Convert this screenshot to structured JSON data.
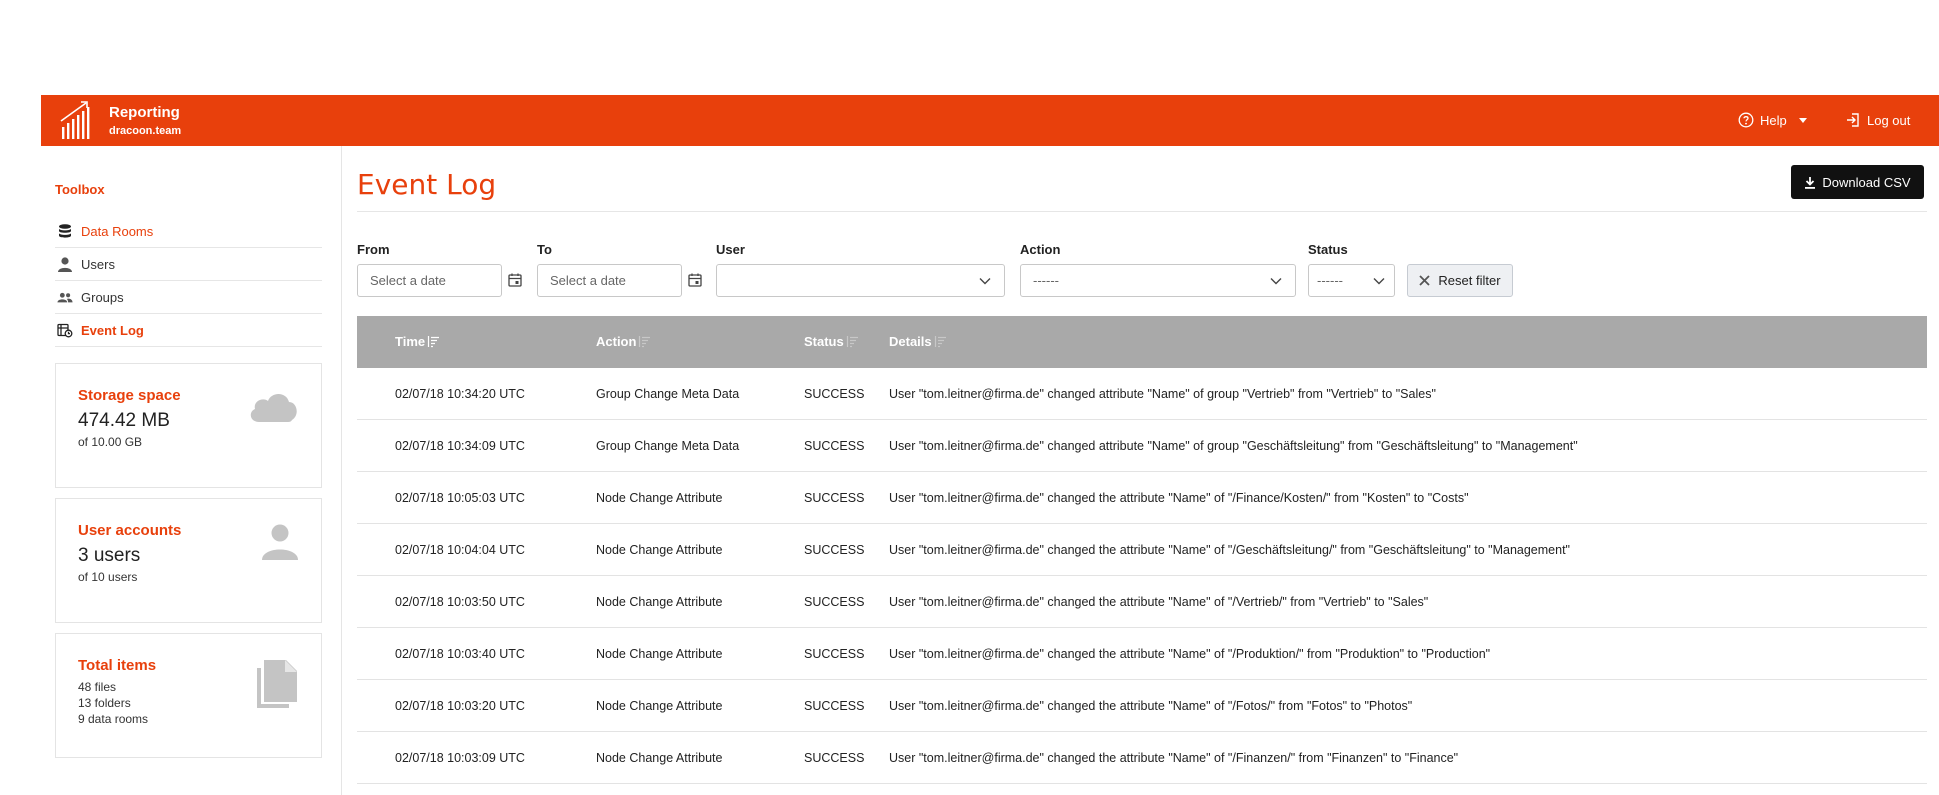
{
  "header": {
    "app_title": "Reporting",
    "app_subtitle": "dracoon.team",
    "help_label": "Help",
    "logout_label": "Log out",
    "brand_color": "#e8400c"
  },
  "sidebar": {
    "toolbox_label": "Toolbox",
    "items": [
      {
        "label": "Data Rooms",
        "icon": "database-icon"
      },
      {
        "label": "Users",
        "icon": "user-icon"
      },
      {
        "label": "Groups",
        "icon": "group-icon"
      },
      {
        "label": "Event Log",
        "icon": "event-log-icon"
      }
    ],
    "cards": [
      {
        "title": "Storage space",
        "value": "474.42 MB",
        "lines": [
          "of 10.00 GB"
        ],
        "icon": "cloud-icon"
      },
      {
        "title": "User accounts",
        "value": "3 users",
        "lines": [
          "of 10 users"
        ],
        "icon": "person-icon"
      },
      {
        "title": "Total items",
        "value": "",
        "lines": [
          "48 files",
          "13 folders",
          "9 data rooms"
        ],
        "icon": "files-icon"
      }
    ]
  },
  "main": {
    "title": "Event Log",
    "download_label": "Download CSV",
    "filters": {
      "from_label": "From",
      "from_placeholder": "Select a date",
      "to_label": "To",
      "to_placeholder": "Select a date",
      "user_label": "User",
      "user_value": "",
      "action_label": "Action",
      "action_value": "------",
      "status_label": "Status",
      "status_value": "------",
      "reset_label": "Reset filter"
    },
    "table": {
      "columns": [
        "Time",
        "Action",
        "Status",
        "Details"
      ],
      "rows": [
        {
          "time": "02/07/18 10:34:20 UTC",
          "action": "Group Change Meta Data",
          "status": "SUCCESS",
          "details": "User \"tom.leitner@firma.de\" changed attribute \"Name\" of group \"Vertrieb\" from \"Vertrieb\" to \"Sales\""
        },
        {
          "time": "02/07/18 10:34:09 UTC",
          "action": "Group Change Meta Data",
          "status": "SUCCESS",
          "details": "User \"tom.leitner@firma.de\" changed attribute \"Name\" of group \"Geschäftsleitung\" from \"Geschäftsleitung\" to \"Management\""
        },
        {
          "time": "02/07/18 10:05:03 UTC",
          "action": "Node Change Attribute",
          "status": "SUCCESS",
          "details": "User \"tom.leitner@firma.de\" changed the attribute \"Name\" of \"/Finance/Kosten/\" from \"Kosten\" to \"Costs\""
        },
        {
          "time": "02/07/18 10:04:04 UTC",
          "action": "Node Change Attribute",
          "status": "SUCCESS",
          "details": "User \"tom.leitner@firma.de\" changed the attribute \"Name\" of \"/Geschäftsleitung/\" from \"Geschäftsleitung\" to \"Management\""
        },
        {
          "time": "02/07/18 10:03:50 UTC",
          "action": "Node Change Attribute",
          "status": "SUCCESS",
          "details": "User \"tom.leitner@firma.de\" changed the attribute \"Name\" of \"/Vertrieb/\" from \"Vertrieb\" to \"Sales\""
        },
        {
          "time": "02/07/18 10:03:40 UTC",
          "action": "Node Change Attribute",
          "status": "SUCCESS",
          "details": "User \"tom.leitner@firma.de\" changed the attribute \"Name\" of \"/Produktion/\" from \"Produktion\" to \"Production\""
        },
        {
          "time": "02/07/18 10:03:20 UTC",
          "action": "Node Change Attribute",
          "status": "SUCCESS",
          "details": "User \"tom.leitner@firma.de\" changed the attribute \"Name\" of \"/Fotos/\" from \"Fotos\" to \"Photos\""
        },
        {
          "time": "02/07/18 10:03:09 UTC",
          "action": "Node Change Attribute",
          "status": "SUCCESS",
          "details": "User \"tom.leitner@firma.de\" changed the attribute \"Name\" of \"/Finanzen/\" from \"Finanzen\" to \"Finance\""
        }
      ]
    }
  }
}
